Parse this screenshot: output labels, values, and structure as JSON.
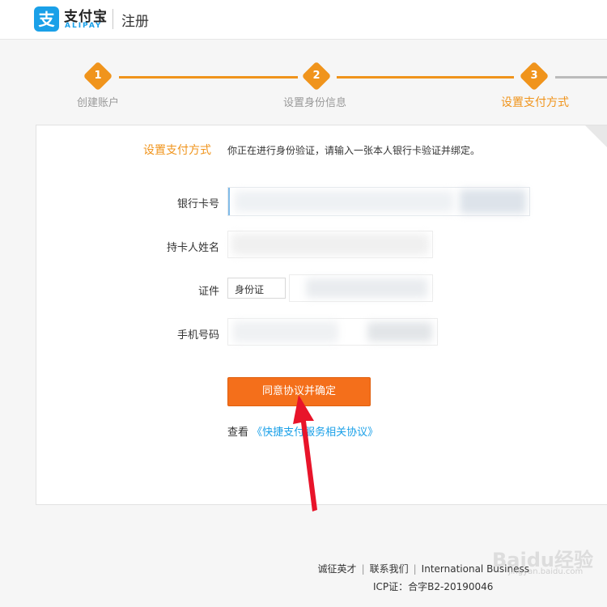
{
  "header": {
    "logo_cn": "支付宝",
    "logo_en": "ALIPAY",
    "title": "注册"
  },
  "steps": [
    {
      "num": "1",
      "label": "创建账户"
    },
    {
      "num": "2",
      "label": "设置身份信息"
    },
    {
      "num": "3",
      "label": "设置支付方式"
    }
  ],
  "form": {
    "intro_title": "设置支付方式",
    "intro_text": "你正在进行身份验证，请输入一张本人银行卡验证并绑定。",
    "bank_card_label": "银行卡号",
    "holder_name_label": "持卡人姓名",
    "id_label": "证件",
    "id_type_value": "身份证",
    "phone_label": "手机号码",
    "confirm_button": "同意协议并确定",
    "view_prefix": "查看",
    "agreement_link": "《快捷支付服务相关协议》"
  },
  "footer": {
    "link1": "诚征英才",
    "link2": "联系我们",
    "link3": "International Business",
    "icp": "ICP证：合字B2-20190046"
  },
  "watermark": {
    "text": "Baidu经验",
    "url_text": "jingyan.baidu.com"
  },
  "colors": {
    "accent": "#f0941c",
    "button": "#f46f1b",
    "link": "#1aa0e8",
    "arrow": "#e8142a"
  },
  "icons": [
    "alipay-logo-icon",
    "page-fold-icon",
    "red-arrow-annotation"
  ]
}
